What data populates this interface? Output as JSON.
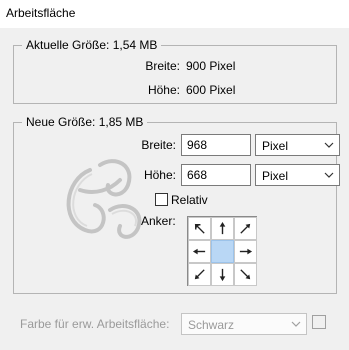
{
  "window": {
    "title": "Arbeitsfläche"
  },
  "current_size": {
    "legend": "Aktuelle Größe: 1,54 MB",
    "width_label": "Breite:",
    "width_value": "900 Pixel",
    "height_label": "Höhe:",
    "height_value": "600 Pixel"
  },
  "new_size": {
    "legend": "Neue Größe: 1,85 MB",
    "width_label": "Breite:",
    "width_value": "968",
    "width_unit": "Pixel",
    "height_label": "Höhe:",
    "height_value": "668",
    "height_unit": "Pixel",
    "relative_label": "Relativ",
    "relative_checked": false,
    "anchor_label": "Anker:",
    "anchor_selected": "center"
  },
  "extension_color": {
    "label": "Farbe für erw. Arbeitsfläche:",
    "value": "Schwarz",
    "enabled": false
  },
  "icons": {
    "dropdown": "chevron-down-icon",
    "anchor_arrows": [
      "arrow-up-left-icon",
      "arrow-up-icon",
      "arrow-up-right-icon",
      "arrow-left-icon",
      "anchor-center",
      "arrow-right-icon",
      "arrow-down-left-icon",
      "arrow-down-icon",
      "arrow-down-right-icon"
    ]
  },
  "colors": {
    "anchor_selected": "#b9d7f5",
    "background": "#f0f0f0"
  }
}
